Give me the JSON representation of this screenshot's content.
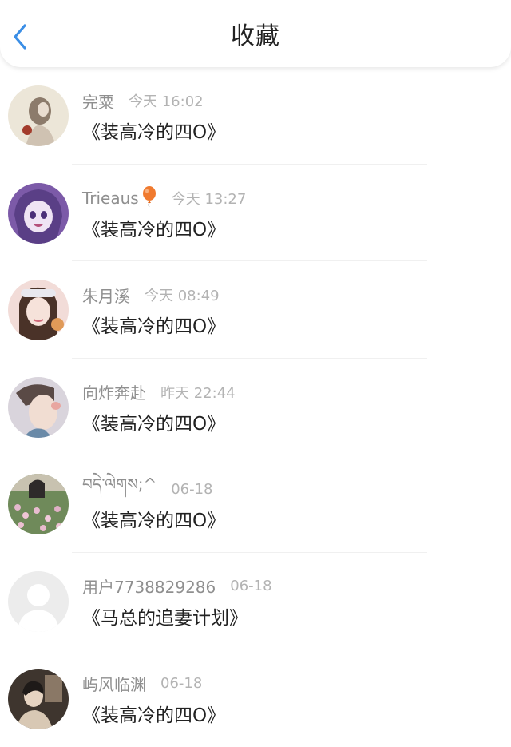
{
  "header": {
    "title": "收藏"
  },
  "items": [
    {
      "user": "完粟",
      "time": "今天 16:02",
      "book": "《装高冷的四O》",
      "avatar": "avatar-1"
    },
    {
      "user": "Trieaus",
      "time": "今天 13:27",
      "book": "《装高冷的四O》",
      "avatar": "avatar-2"
    },
    {
      "user": "朱月溪",
      "time": "今天 08:49",
      "book": "《装高冷的四O》",
      "avatar": "avatar-3"
    },
    {
      "user": "向炸奔赴",
      "time": "昨天 22:44",
      "book": "《装高冷的四O》",
      "avatar": "avatar-4"
    },
    {
      "user": "བདེ་ལེགས;^",
      "time": "06-18",
      "book": "《装高冷的四O》",
      "avatar": "avatar-5"
    },
    {
      "user": "用户7738829286",
      "time": "06-18",
      "book": "《马总的追妻计划》",
      "avatar": "avatar-default"
    },
    {
      "user": "屿风临渊",
      "time": "06-18",
      "book": "《装高冷的四O》",
      "avatar": "avatar-7"
    }
  ],
  "icons": {
    "back": "chevron-left-icon",
    "badge": "balloon-icon"
  },
  "colors": {
    "accent": "#3a8ee6",
    "time": "#b3b3b3",
    "username": "#8f8f8f",
    "text": "#222222"
  }
}
